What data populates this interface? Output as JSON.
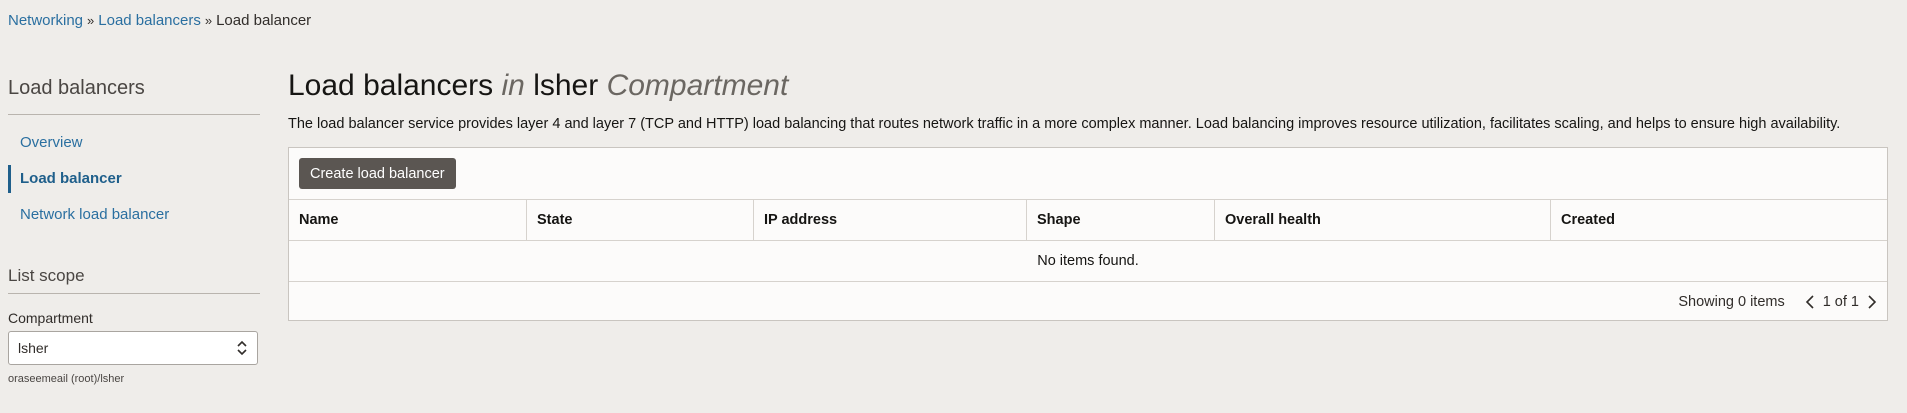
{
  "breadcrumb": {
    "items": [
      "Networking",
      "Load balancers"
    ],
    "current": "Load balancer",
    "separator": "»"
  },
  "sidebar": {
    "title": "Load balancers",
    "nav": [
      {
        "label": "Overview",
        "active": false
      },
      {
        "label": "Load balancer",
        "active": true
      },
      {
        "label": "Network load balancer",
        "active": false
      }
    ],
    "scope_title": "List scope",
    "compartment_label": "Compartment",
    "compartment_value": "lsher",
    "compartment_path": "oraseemeail (root)/lsher"
  },
  "main": {
    "title_part1": "Load balancers",
    "title_in": "in",
    "title_compartment": "lsher",
    "title_suffix": "Compartment",
    "description": "The load balancer service provides layer 4 and layer 7 (TCP and HTTP) load balancing that routes network traffic in a more complex manner. Load balancing improves resource utilization, facilitates scaling, and helps to ensure high availability.",
    "create_button": "Create load balancer",
    "columns": [
      "Name",
      "State",
      "IP address",
      "Shape",
      "Overall health",
      "Created"
    ],
    "empty_message": "No items found.",
    "showing": "Showing 0 items",
    "page_indicator": "1 of 1"
  },
  "colors": {
    "link": "#2a6fa0",
    "button_bg": "#5b5652",
    "page_bg": "#efedea"
  }
}
